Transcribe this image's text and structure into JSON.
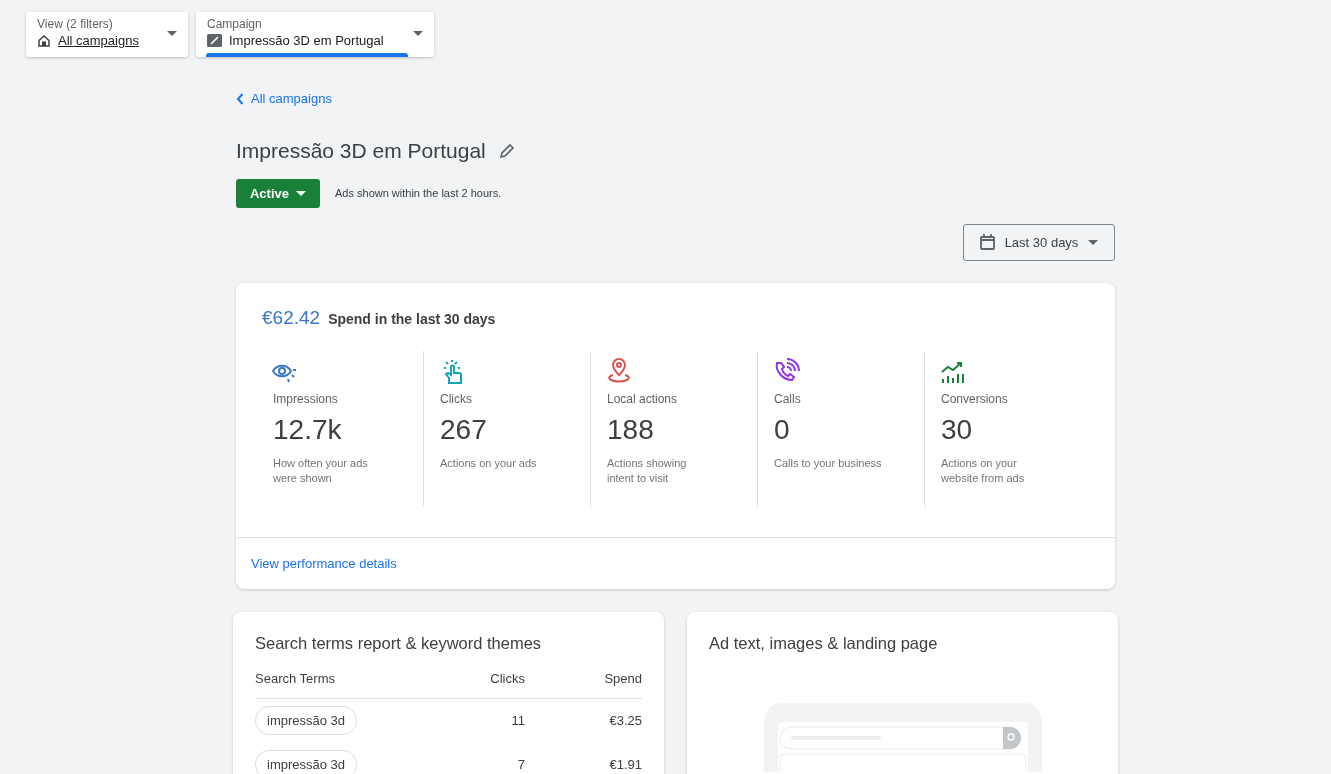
{
  "filters": [
    {
      "label": "View (2 filters)",
      "value": "All campaigns",
      "kind": "view",
      "selected": false
    },
    {
      "label": "Campaign",
      "value": "Impressão 3D em Portugal",
      "kind": "campaign",
      "selected": true
    }
  ],
  "back_link": "All campaigns",
  "campaign": {
    "title": "Impressão 3D em Portugal",
    "status": "Active",
    "status_note": "Ads shown within the last 2 hours."
  },
  "date_range": "Last 30 days",
  "summary": {
    "spend": "€62.42",
    "spend_label": "Spend in the last 30 days",
    "metrics": [
      {
        "name": "Impressions",
        "value": "12.7k",
        "description": "How often your ads were shown",
        "color": "#3b78c4"
      },
      {
        "name": "Clicks",
        "value": "267",
        "description": "Actions on your ads",
        "color": "#12a4b8"
      },
      {
        "name": "Local actions",
        "value": "188",
        "description": "Actions showing intent to visit",
        "color": "#d9534f"
      },
      {
        "name": "Calls",
        "value": "0",
        "description": "Calls to your business",
        "color": "#9334e6"
      },
      {
        "name": "Conversions",
        "value": "30",
        "description": "Actions on your website from ads",
        "color": "#188038"
      }
    ],
    "details_link": "View performance details"
  },
  "search_terms": {
    "title": "Search terms report & keyword themes",
    "columns": [
      "Search Terms",
      "Clicks",
      "Spend"
    ],
    "rows": [
      {
        "term": "impressão 3d",
        "clicks": "11",
        "spend": "€3.25"
      },
      {
        "term": "impressão 3d",
        "clicks": "7",
        "spend": "€1.91"
      }
    ]
  },
  "ad_card": {
    "title": "Ad text, images & landing page"
  }
}
